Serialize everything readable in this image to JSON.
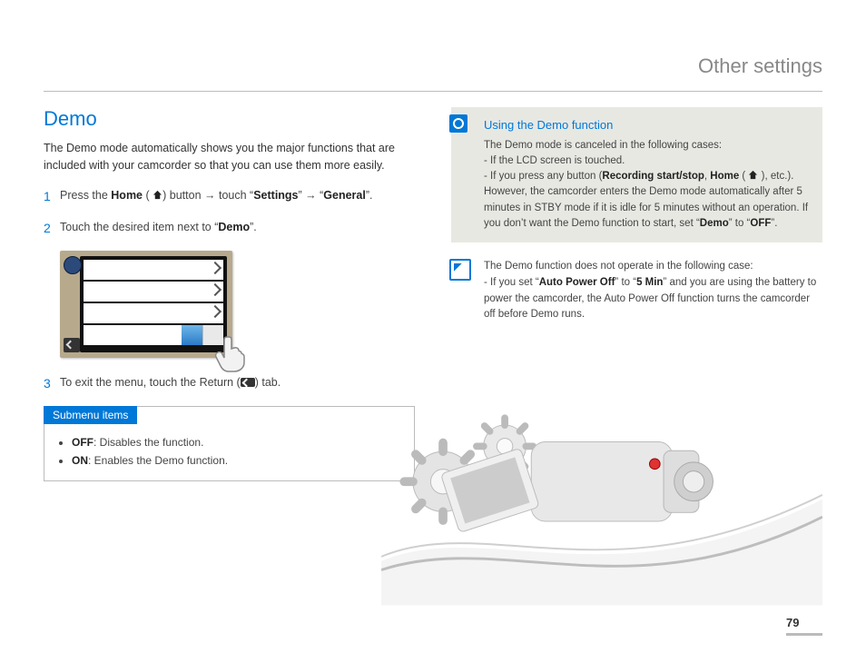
{
  "header": {
    "section_title": "Other settings"
  },
  "page_number": "79",
  "left": {
    "title": "Demo",
    "intro": "The Demo mode automatically shows you the major functions that are included with your camcorder so that you can use them more easily.",
    "steps": {
      "s1_a": "Press the ",
      "s1_home": "Home",
      "s1_b": " (",
      "s1_c": ") button → touch “",
      "s1_settings": "Settings",
      "s1_d": "” → “",
      "s1_general": "General",
      "s1_e": "”.",
      "s2_a": "Touch the desired item next to “",
      "s2_demo": "Demo",
      "s2_b": "”.",
      "s3_a": "To exit the menu, touch the Return (",
      "s3_b": ") tab."
    },
    "submenu": {
      "heading": "Submenu items",
      "off_label": "OFF",
      "off_text": ": Disables the function.",
      "on_label": "ON",
      "on_text": ": Enables the Demo function."
    }
  },
  "right": {
    "magnify": {
      "title": "Using the Demo function",
      "line1": "The Demo mode is canceled in the following cases:",
      "line2": "- If the LCD screen is touched.",
      "line3_a": "- If you press any button (",
      "line3_rec": "Recording start/stop",
      "line3_b": ", ",
      "line3_home": "Home",
      "line3_c": " (",
      "line3_d": "), etc.). However, the camcorder enters the Demo mode automatically after 5 minutes in STBY mode if it is idle for 5 minutes without an operation. If you don’t want the Demo function to start, set “",
      "line3_demo": "Demo",
      "line3_e": "” to “",
      "line3_off": "OFF",
      "line3_f": "”."
    },
    "pencil": {
      "line1": "The Demo function does not operate in the following case:",
      "line2_a": "- If you set “",
      "line2_apo": "Auto Power Off",
      "line2_b": "” to “",
      "line2_5min": "5 Min",
      "line2_c": "” and you are using the battery to power the camcorder, the Auto Power Off function turns the camcorder off before Demo runs."
    }
  }
}
